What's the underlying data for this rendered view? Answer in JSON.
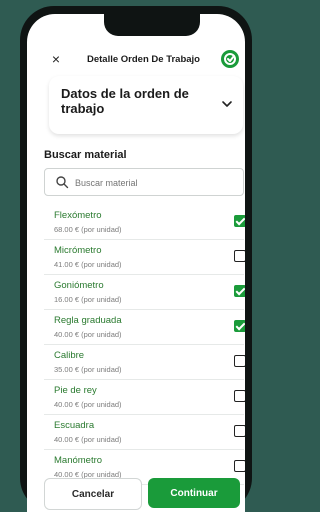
{
  "header": {
    "close_symbol": "×",
    "title": "Detalle Orden De Trabajo",
    "status_icon": "check-circle-icon",
    "accent_color": "#1a9b3a"
  },
  "order_card": {
    "title": "Datos de la orden de trabajo",
    "chevron_icon": "chevron-down-icon"
  },
  "materials": {
    "section_title": "Buscar material",
    "search_placeholder": "Buscar material",
    "items": [
      {
        "name": "Flexómetro",
        "price": "68.00 € (por unidad)",
        "checked": true
      },
      {
        "name": "Micrómetro",
        "price": "41.00 € (por unidad)",
        "checked": false
      },
      {
        "name": "Goniómetro",
        "price": "16.00 € (por unidad)",
        "checked": true
      },
      {
        "name": "Regla graduada",
        "price": "40.00 € (por unidad)",
        "checked": true
      },
      {
        "name": "Calibre",
        "price": "35.00 € (por unidad)",
        "checked": false
      },
      {
        "name": "Pie de rey",
        "price": "40.00 € (por unidad)",
        "checked": false
      },
      {
        "name": "Escuadra",
        "price": "40.00 € (por unidad)",
        "checked": false
      },
      {
        "name": "Manómetro",
        "price": "40.00 € (por unidad)",
        "checked": false
      }
    ]
  },
  "footer": {
    "cancel_label": "Cancelar",
    "continue_label": "Continuar"
  }
}
